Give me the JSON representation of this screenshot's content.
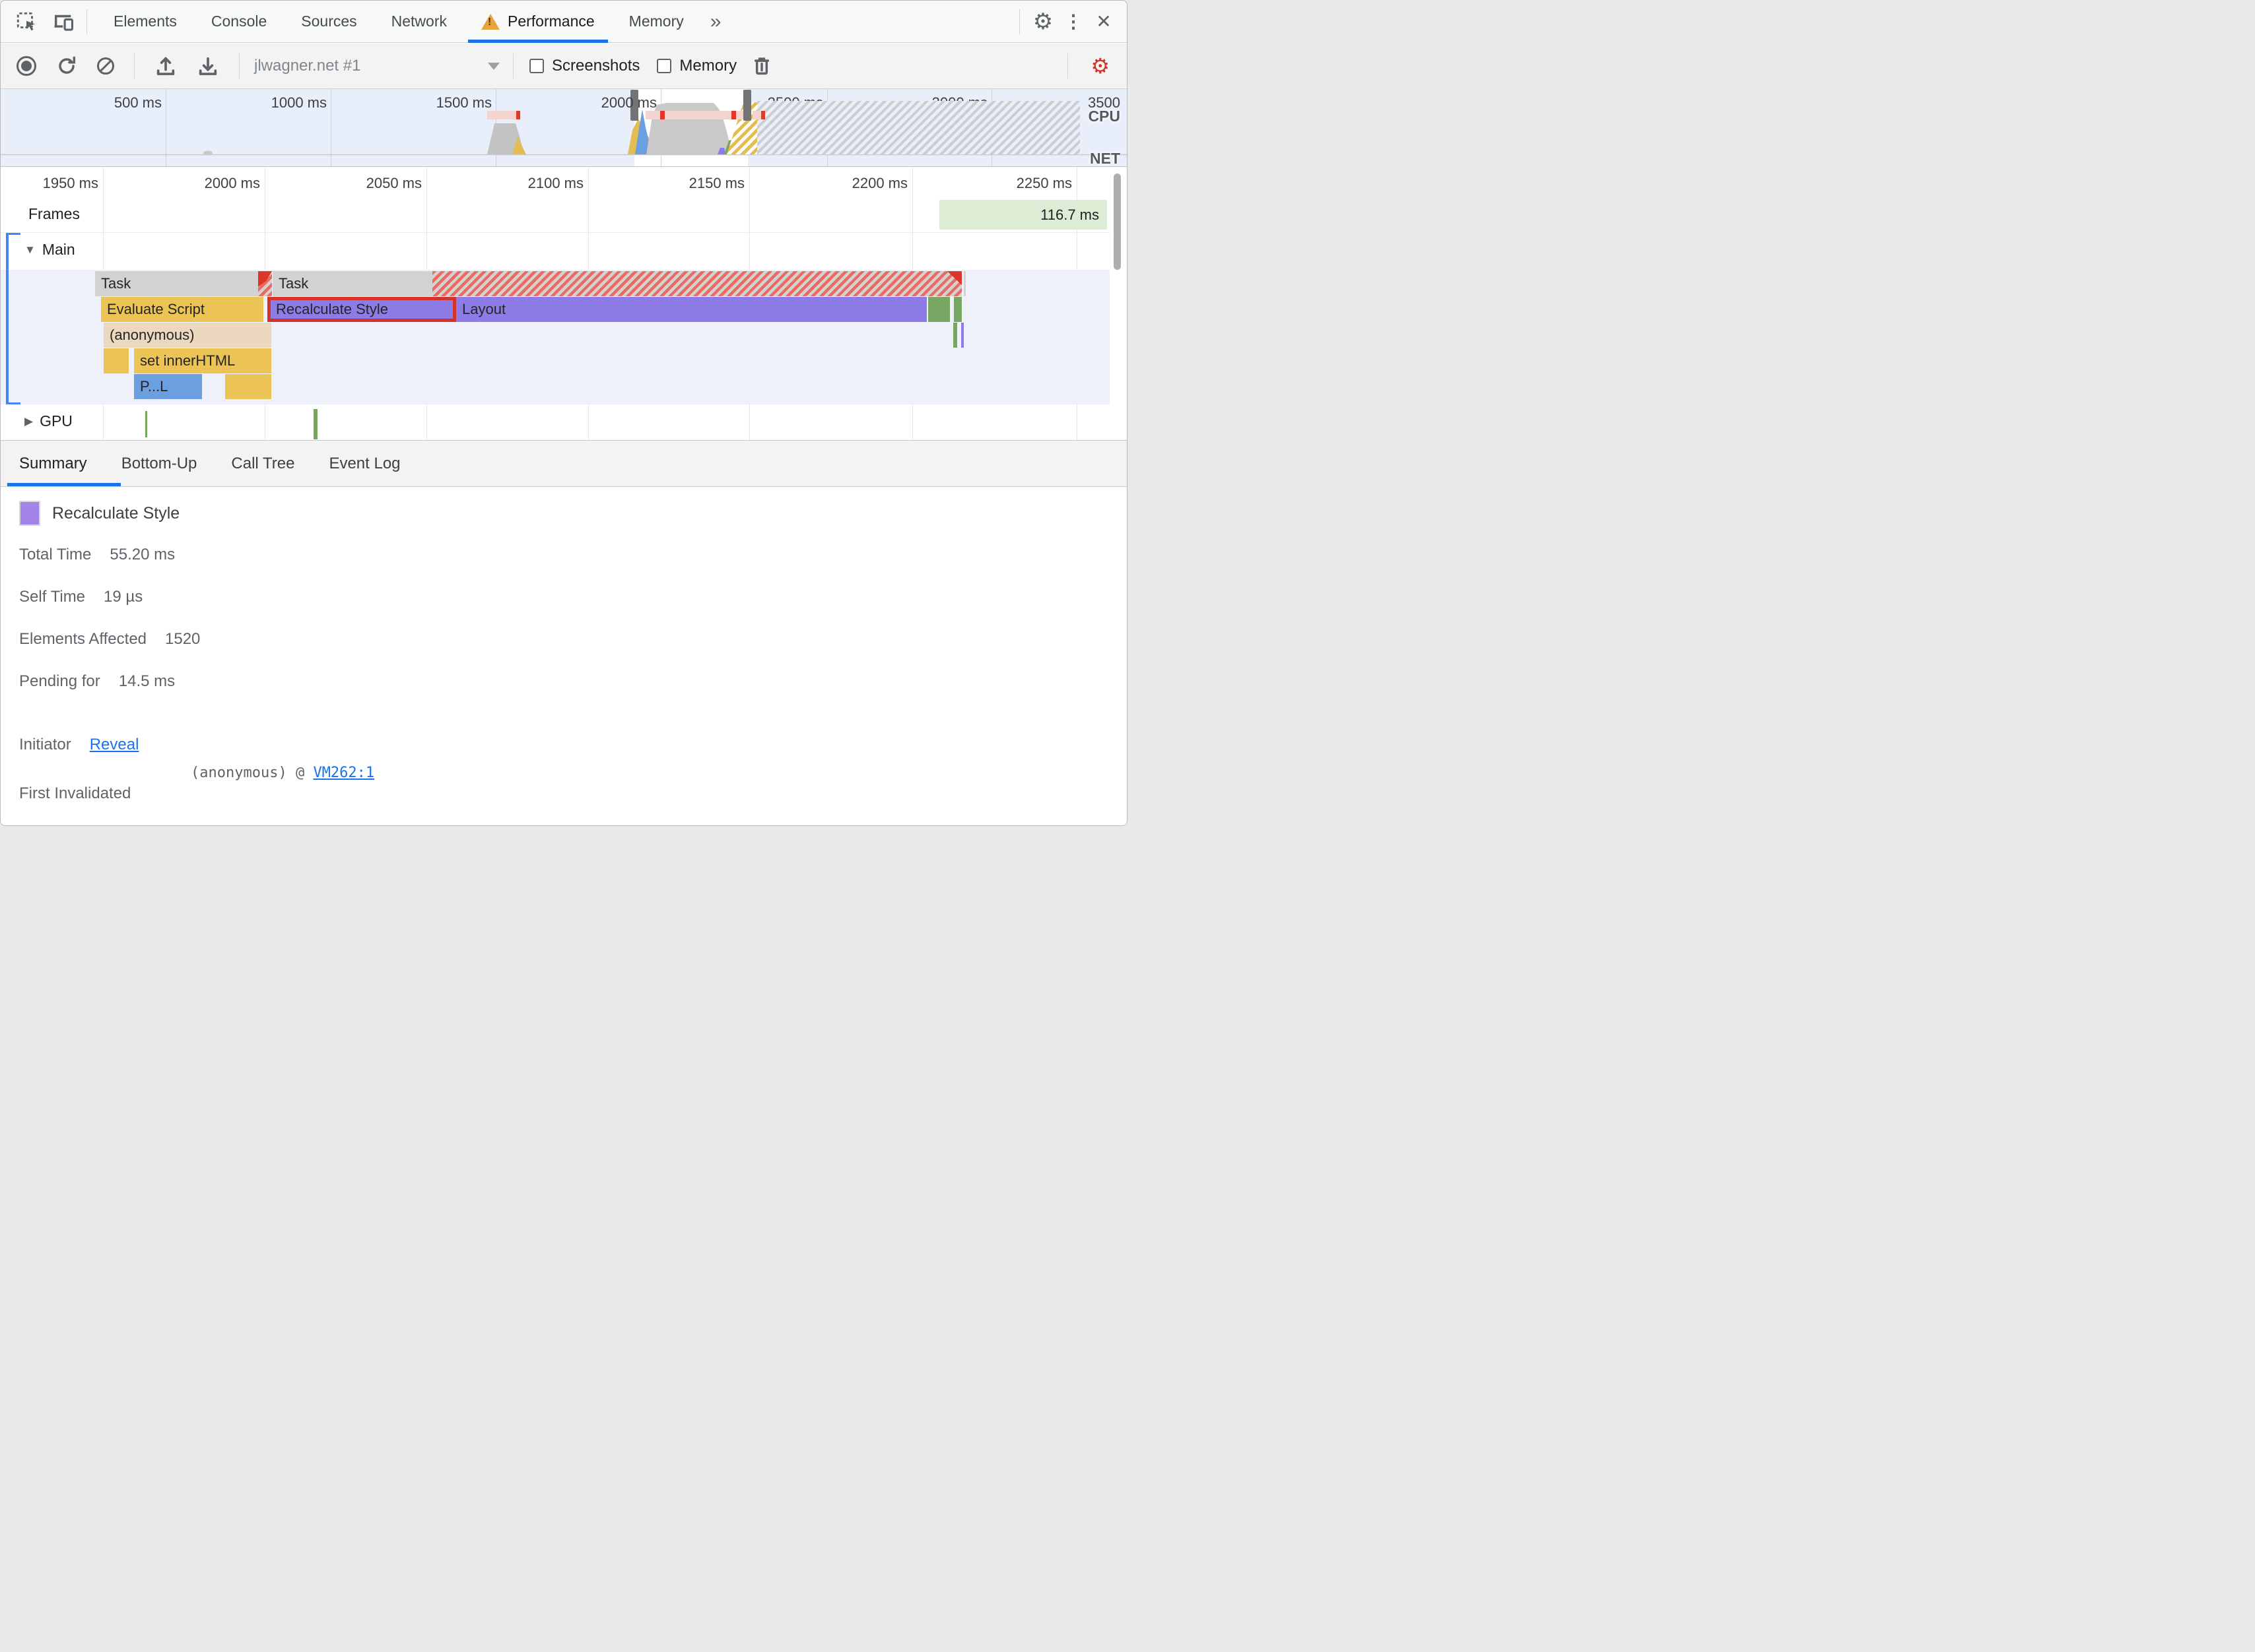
{
  "tab_bar": {
    "tabs": [
      {
        "label": "Elements"
      },
      {
        "label": "Console"
      },
      {
        "label": "Sources"
      },
      {
        "label": "Network"
      },
      {
        "label": "Performance",
        "active": true,
        "warning": true
      },
      {
        "label": "Memory"
      }
    ],
    "more_tabs_glyph": "»"
  },
  "icons": {
    "gear": "⚙",
    "kebab": "⋮",
    "close": "✕",
    "main_expanded": "▼",
    "gpu_collapsed": "▶"
  },
  "toolbar": {
    "profile_name": "jlwagner.net #1",
    "screenshots_label": "Screenshots",
    "memory_label": "Memory"
  },
  "overview": {
    "ticks": [
      "500 ms",
      "1000 ms",
      "1500 ms",
      "2000 ms",
      "2500 ms",
      "3000 ms",
      "3500"
    ],
    "cpu_label": "CPU",
    "net_label": "NET"
  },
  "detail": {
    "ticks": [
      "1950 ms",
      "2000 ms",
      "2050 ms",
      "2100 ms",
      "2150 ms",
      "2200 ms",
      "2250 ms"
    ],
    "frames_label": "Frames",
    "frame_duration": "116.7 ms",
    "main_label": "Main",
    "gpu_label": "GPU",
    "bars": {
      "task1": "Task",
      "task2": "Task",
      "evaluate_script": "Evaluate Script",
      "recalculate_style": "Recalculate Style",
      "layout": "Layout",
      "anonymous": "(anonymous)",
      "set_inner_html": "set innerHTML",
      "profile_call": "P...L"
    }
  },
  "bottom_tabs": [
    "Summary",
    "Bottom-Up",
    "Call Tree",
    "Event Log"
  ],
  "summary": {
    "title": "Recalculate Style",
    "rows": [
      {
        "label": "Total Time",
        "value": "55.20 ms"
      },
      {
        "label": "Self Time",
        "value": "19 µs"
      },
      {
        "label": "Elements Affected",
        "value": "1520"
      },
      {
        "label": "Pending for",
        "value": "14.5 ms"
      }
    ],
    "initiator_label": "Initiator",
    "initiator_link": "Reveal",
    "first_invalidated_label": "First Invalidated",
    "first_invalidated_fn": "(anonymous) @ ",
    "first_invalidated_link": "VM262:1"
  },
  "colors": {
    "accent_blue": "#1a73e8",
    "scripting_yellow": "#ecc455",
    "rendering_purple": "#8d7ce8",
    "painting_green": "#78a763",
    "function_beige": "#ecd8bf",
    "task_gray": "#d2d2d2",
    "long_task_red": "#e96c63",
    "selection_red_border": "#d2342a",
    "frames_green": "#dcecd5",
    "warning_amber": "#e8a33d",
    "record_gear_red": "#d93025"
  }
}
